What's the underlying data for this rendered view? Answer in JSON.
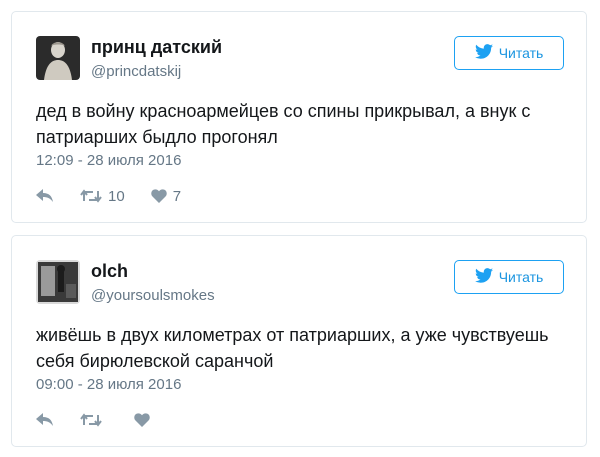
{
  "follow_label": "Читать",
  "tweets": [
    {
      "name": "принц датский",
      "handle": "@princdatskij",
      "text": "дед в войну красноармейцев со спины прикрывал, а внук с патриарших быдло прогонял",
      "time": "12:09 - 28 июля 2016",
      "retweets": "10",
      "likes": "7"
    },
    {
      "name": "olch",
      "handle": "@yoursoulsmokes",
      "text": "живёшь в двух километрах от патриарших, а уже чувствуешь себя бирюлевской саранчой",
      "time": "09:00 - 28 июля 2016",
      "retweets": "",
      "likes": ""
    }
  ],
  "colors": {
    "accent": "#1da1f2",
    "muted": "#657786",
    "icon": "#8899a6",
    "border": "#e1e8ed"
  },
  "icons": [
    "twitter-bird-icon",
    "reply-icon",
    "retweet-icon",
    "heart-icon"
  ]
}
